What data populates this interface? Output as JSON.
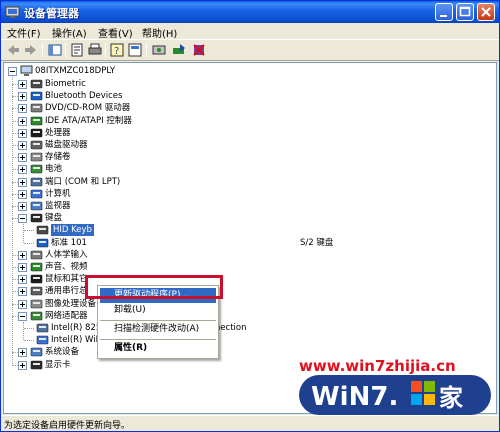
{
  "window": {
    "title": "设备管理器"
  },
  "menu": [
    {
      "label": "文件(F)",
      "name": "menu-file"
    },
    {
      "label": "操作(A)",
      "name": "menu-action"
    },
    {
      "label": "查看(V)",
      "name": "menu-view"
    },
    {
      "label": "帮助(H)",
      "name": "menu-help"
    }
  ],
  "toolbar_icons": [
    "back-icon",
    "forward-icon",
    "show-tree-icon",
    "properties-icon",
    "print-icon",
    "help-icon",
    "view-icon",
    "scan-hardware-icon",
    "update-driver-icon",
    "disable-device-icon"
  ],
  "tree": {
    "root": "08ITXMZC018DPLY",
    "items": [
      {
        "label": "Biometric",
        "level": 1,
        "state": "collapsed",
        "icon": "biometric-icon"
      },
      {
        "label": "Bluetooth Devices",
        "level": 1,
        "state": "collapsed",
        "icon": "bluetooth-icon"
      },
      {
        "label": "DVD/CD-ROM 驱动器",
        "level": 1,
        "state": "collapsed",
        "icon": "dvd-icon"
      },
      {
        "label": "IDE ATA/ATAPI 控制器",
        "level": 1,
        "state": "collapsed",
        "icon": "ide-controller-icon"
      },
      {
        "label": "处理器",
        "level": 1,
        "state": "collapsed",
        "icon": "processor-icon"
      },
      {
        "label": "磁盘驱动器",
        "level": 1,
        "state": "collapsed",
        "icon": "disk-drive-icon"
      },
      {
        "label": "存储卷",
        "level": 1,
        "state": "collapsed",
        "icon": "storage-volume-icon"
      },
      {
        "label": "电池",
        "level": 1,
        "state": "collapsed",
        "icon": "battery-icon"
      },
      {
        "label": "端口 (COM 和 LPT)",
        "level": 1,
        "state": "collapsed",
        "icon": "port-icon"
      },
      {
        "label": "计算机",
        "level": 1,
        "state": "collapsed",
        "icon": "computer-icon"
      },
      {
        "label": "监视器",
        "level": 1,
        "state": "collapsed",
        "icon": "monitor-icon"
      },
      {
        "label": "键盘",
        "level": 1,
        "state": "expanded",
        "icon": "keyboard-icon"
      },
      {
        "label": "HID Keyb",
        "level": 2,
        "state": "leaf",
        "selected": true,
        "icon": "keyboard-icon"
      },
      {
        "label": "标准 101",
        "suffix": "S/2 键盘",
        "level": 2,
        "state": "leaf",
        "icon": "keyboard-icon"
      },
      {
        "label": "人体学输入",
        "level": 1,
        "state": "collapsed",
        "icon": "hid-icon"
      },
      {
        "label": "声音、视频",
        "level": 1,
        "state": "collapsed",
        "icon": "sound-icon"
      },
      {
        "label": "鼠标和其它",
        "level": 1,
        "state": "collapsed",
        "icon": "mouse-icon"
      },
      {
        "label": "通用串行总",
        "level": 1,
        "state": "collapsed",
        "icon": "usb-icon"
      },
      {
        "label": "图像处理设备",
        "level": 1,
        "state": "collapsed",
        "icon": "imaging-icon"
      },
      {
        "label": "网络适配器",
        "level": 1,
        "state": "expanded",
        "icon": "network-adapter-icon"
      },
      {
        "label": "Intel(R) 82567LM Gigabit Network Connection",
        "level": 2,
        "state": "leaf",
        "icon": "network-card-icon"
      },
      {
        "label": "Intel(R) WiFi Link 5300 AGN",
        "level": 2,
        "state": "leaf",
        "icon": "network-card-icon"
      },
      {
        "label": "系统设备",
        "level": 1,
        "state": "collapsed",
        "icon": "system-device-icon"
      },
      {
        "label": "显示卡",
        "level": 1,
        "state": "collapsed",
        "icon": "display-adapter-icon"
      }
    ]
  },
  "context_menu": {
    "items": [
      {
        "label": "更新驱动程序(P)...",
        "highlighted": true
      },
      {
        "label": "卸载(U)"
      },
      {
        "separator": true
      },
      {
        "label": "扫描检测硬件改动(A)"
      },
      {
        "separator": true
      },
      {
        "label": "属性(R)",
        "bold": true
      }
    ]
  },
  "status": {
    "text": "为选定设备启用硬件更新向导。"
  },
  "watermark": {
    "url": "www.win7zhijia.cn",
    "logo_text": "Win7.家"
  },
  "colors": {
    "titlebar": "#0A4FD0",
    "selection": "#316AC5",
    "highlight_box": "#C8102E",
    "chrome": "#ECE9D8"
  }
}
